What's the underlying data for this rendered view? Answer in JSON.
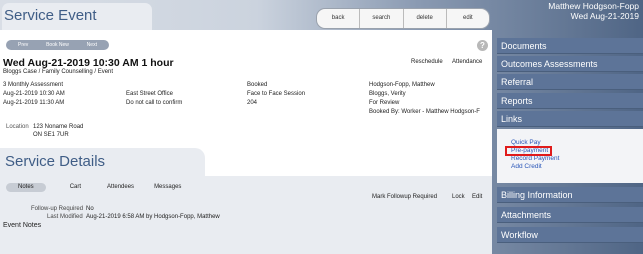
{
  "header": {
    "title": "Service Event",
    "toolbar": [
      "back",
      "search",
      "delete",
      "edit"
    ],
    "user": "Matthew Hodgson-Fopp",
    "date": "Wed Aug-21-2019"
  },
  "nav": [
    "Prev",
    "Book New",
    "Next"
  ],
  "event": {
    "datetime": "Wed Aug-21-2019 10:30 AM  1 hour",
    "subtitle": "Bloggs Case / Family Counselling / Event",
    "actions": {
      "reschedule": "Reschedule",
      "attendance": "Attendance"
    },
    "grid": {
      "c1": [
        "3 Monthly Assessment",
        "Aug-21-2019 10:30 AM",
        "Aug-21-2019 11:30 AM"
      ],
      "c2": [
        "",
        "East Street Office",
        "Do not call to confirm"
      ],
      "c3": [
        "Booked",
        "Face to Face Session",
        "204"
      ],
      "c4": [
        "Hodgson-Fopp, Matthew",
        "Bloggs, Verity",
        "For Review",
        "Booked By: Worker - Matthew Hodgson-F"
      ]
    },
    "location": {
      "label": "Location",
      "line1": "123 Noname Road",
      "line2": "ON SE1 7UR"
    }
  },
  "details": {
    "title": "Service Details",
    "tabs": [
      "Notes",
      "Cart",
      "Attendees",
      "Messages"
    ],
    "actions": {
      "followup": "Mark Followup Required",
      "lock": "Lock",
      "edit": "Edit"
    },
    "followup_label": "Follow-up Required",
    "followup_value": "No",
    "modified_label": "Last Modified",
    "modified_value": "Aug-21-2019 6:58 AM by Hodgson-Fopp, Matthew",
    "notes_label": "Event Notes"
  },
  "sidebar": {
    "items_top": [
      "Documents",
      "Outcomes Assessments",
      "Referral",
      "Reports",
      "Links"
    ],
    "links": [
      "Quick Pay",
      "Pre-payment",
      "Record Payment",
      "Add Credit"
    ],
    "items_bottom": [
      "Billing Information",
      "Attachments",
      "Workflow"
    ]
  },
  "icons": {
    "help": "help-icon"
  }
}
